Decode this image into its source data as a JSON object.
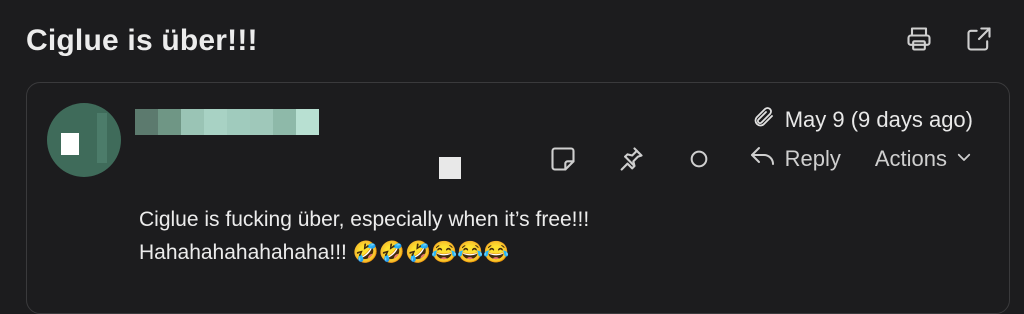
{
  "subject": "Ciglue is über!!!",
  "toolbar": {
    "print_icon": "printer-icon",
    "popout_icon": "open-external-icon"
  },
  "message": {
    "date": "May 9 (9 days ago)",
    "reply_label": "Reply",
    "actions_label": "Actions",
    "body_line1": "Ciglue is fucking über, especially when it’s free!!!",
    "body_line2": "Hahahahahahahaha!!! 🤣🤣🤣😂😂😂",
    "colors": {
      "avatar": "#3f6b5a",
      "sender_blur": [
        "#5c7a6e",
        "#6f9685",
        "#9ac4b5",
        "#a8d2c4",
        "#a0cbbd",
        "#9fc8ba",
        "#8eb9a9",
        "#b8e0d2"
      ]
    }
  }
}
